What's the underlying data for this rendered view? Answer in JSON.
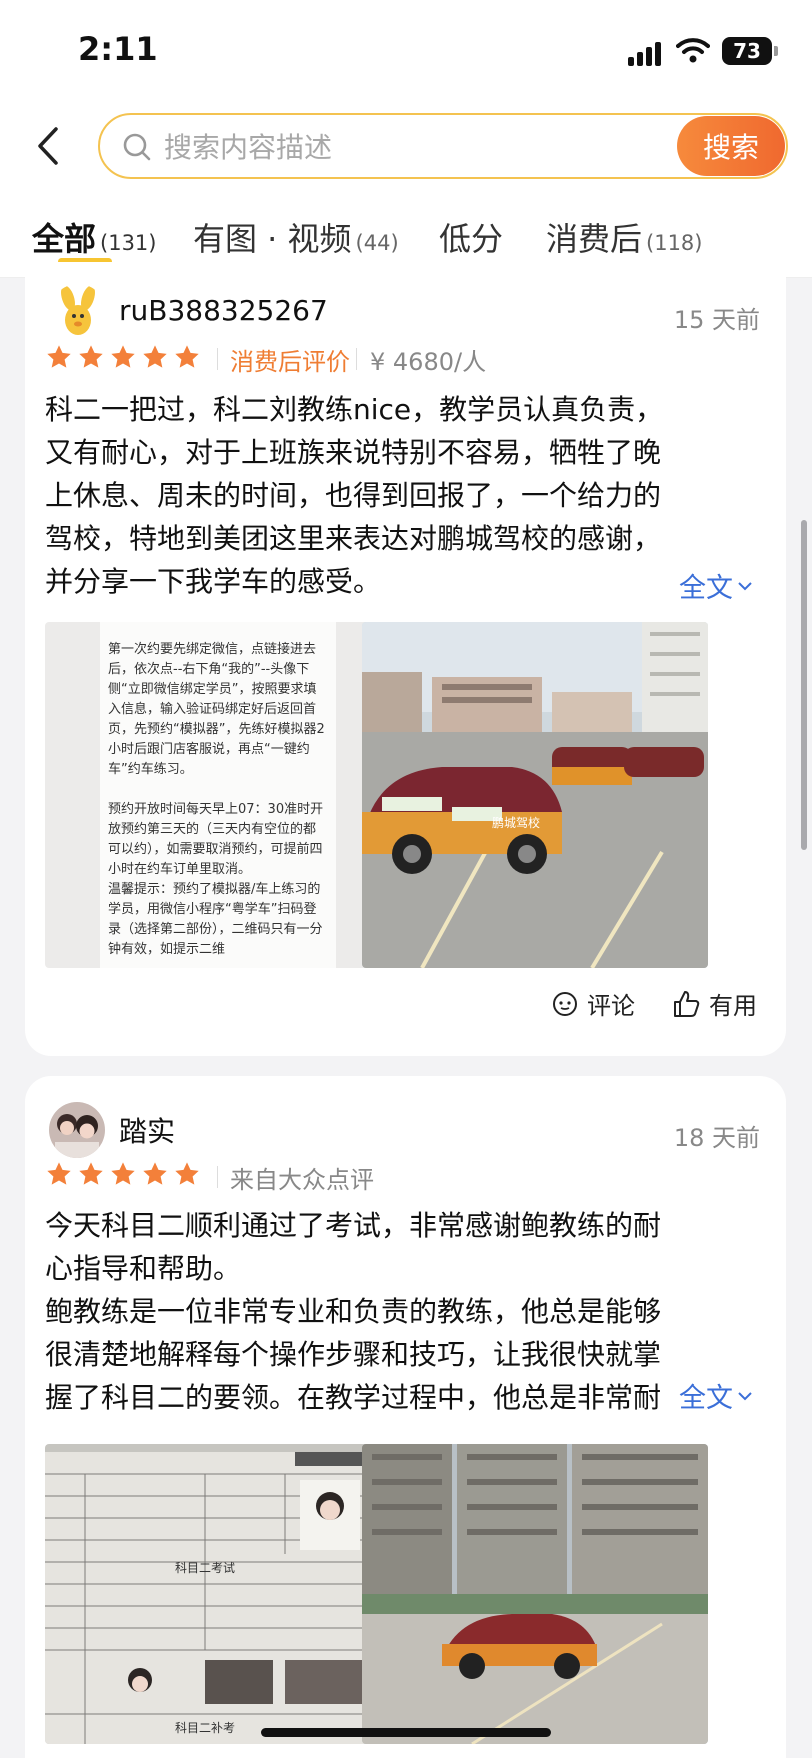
{
  "status_bar": {
    "time": "2:11",
    "battery": "73"
  },
  "search": {
    "placeholder": "搜索内容描述",
    "button_label": "搜索"
  },
  "tabs": [
    {
      "label": "全部",
      "count": "(131)"
    },
    {
      "label": "有图 · 视频",
      "count": "(44)"
    },
    {
      "label": "低分",
      "count": ""
    },
    {
      "label": "消费后",
      "count": "(118)"
    }
  ],
  "reviews": [
    {
      "username": "ruB388325267",
      "time_ago": "15 天前",
      "rating": 5,
      "tag": "消费后评价",
      "price": "¥ 4680/人",
      "text": "科二一把过，科二刘教练nice，教学员认真负责，又有耐心，对于上班族来说特别不容易，牺牲了晚上休息、周未的时间，也得到回报了，一个给力的驾校，特地到美团这里来表达对鹏城驾校的感谢，并分享一下我学车的感受。",
      "more_label": "全文",
      "photo1_text": "第一次约要先绑定微信，点链接进去后，依次点--右下角“我的”--头像下侧“立即微信绑定学员”，按照要求填入信息，输入验证码绑定好后返回首页，先预约“模拟器”，先练好模拟器2小时后跟门店客服说，再点“一键约车”约车练习。\n\n预约开放时间每天早上07：30准时开放预约第三天的（三天内有空位的都可以约），如需要取消预约，可提前四小时在约车订单里取消。\n温馨提示：预约了模拟器/车上练习的学员，用微信小程序“粤学车”扫码登录（选择第二部份），二维码只有一分钟有效，如提示二维",
      "photo2_car_text": "鹏城驾校",
      "comment_label": "评论",
      "useful_label": "有用"
    },
    {
      "username": "踏实",
      "time_ago": "18 天前",
      "rating": 5,
      "source": "来自大众点评",
      "text_p1": "今天科目二顺利通过了考试，非常感谢鲍教练的耐心指导和帮助。",
      "text_p2": "鲍教练是一位非常专业和负责的教练，他总是能够很清楚地解释每个操作步骤和技巧，让我很快就掌握了科目二的要领。在教学过程中，他总是非常耐心",
      "more_label": "全文",
      "doc_title": "科目二考试",
      "doc_footer": "科目二补考"
    }
  ]
}
